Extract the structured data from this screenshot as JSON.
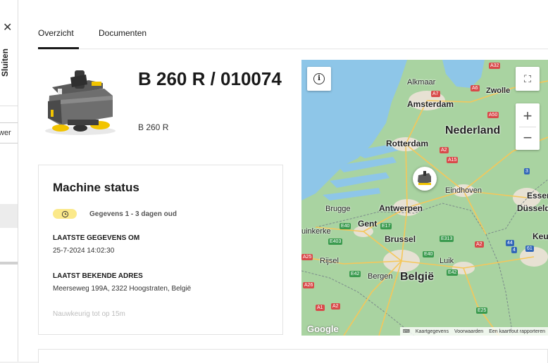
{
  "sidebar": {
    "close_label": "Sluiten",
    "partial_input_text": "wer"
  },
  "tabs": [
    {
      "label": "Overzicht",
      "active": true
    },
    {
      "label": "Documenten",
      "active": false
    }
  ],
  "machine": {
    "title": "B 260 R / 010074",
    "model": "B 260 R"
  },
  "status": {
    "heading": "Machine status",
    "badge_text": "Gegevens 1 - 3 dagen oud",
    "last_data_label": "LAATSTE GEGEVENS OM",
    "last_data_value": "25-7-2024 14:02:30",
    "last_address_label": "LAATST BEKENDE ADRES",
    "last_address_value": "Meerseweg 199A, 2322 Hoogstraten, België",
    "accuracy_hint": "Nauwkeurig tot op 15m"
  },
  "map": {
    "labels": {
      "alkmaar": "Alkmaar",
      "zwolle": "Zwolle",
      "amsterdam": "Amsterdam",
      "nederland": "Nederland",
      "rotterdam": "Rotterdam",
      "eindhoven": "Eindhoven",
      "essen": "Essen",
      "dusseldorf": "Düsseld",
      "brugge": "Brugge",
      "antwerpen": "Antwerpen",
      "gent": "Gent",
      "duinkerke": "uinkerke",
      "brussel": "Brussel",
      "keulen": "Keu",
      "rijsel": "Rijsel",
      "luik": "Luik",
      "bergen": "Bergen",
      "belgie": "België"
    },
    "roads": {
      "a32": "A32",
      "a7": "A7",
      "a6": "A6",
      "a50": "A50",
      "a2": "A2",
      "a15": "A15",
      "e40": "E40",
      "e17": "E17",
      "e403": "E403",
      "a25": "A25",
      "e313": "E313",
      "e40b": "E40",
      "e42": "E42",
      "e42b": "E42",
      "a26": "A26",
      "a1": "A1",
      "a2b": "A2",
      "e25": "E25",
      "r3": "3",
      "r44": "44",
      "r4": "4",
      "r61": "61",
      "a2c": "A2"
    },
    "attribution": {
      "data": "Kaartgegevens",
      "terms": "Voorwaarden",
      "report": "Een kaartfout rapporteren"
    },
    "logo": "Google",
    "colors": {
      "land": "#a9d3a1",
      "water": "#8ec6e8",
      "urban": "#e7e1d3"
    }
  }
}
